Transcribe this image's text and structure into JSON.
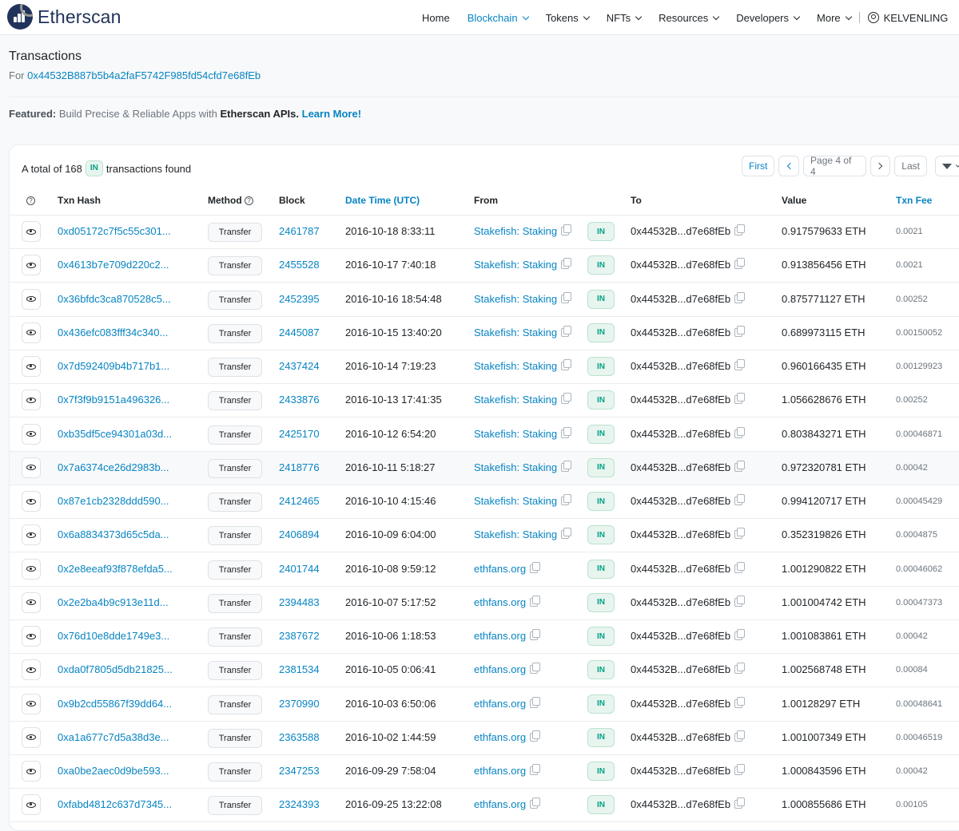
{
  "header": {
    "logo_text": "Etherscan",
    "nav": [
      {
        "label": "Home",
        "dropdown": false,
        "active": false
      },
      {
        "label": "Blockchain",
        "dropdown": true,
        "active": true
      },
      {
        "label": "Tokens",
        "dropdown": true,
        "active": false
      },
      {
        "label": "NFTs",
        "dropdown": true,
        "active": false
      },
      {
        "label": "Resources",
        "dropdown": true,
        "active": false
      },
      {
        "label": "Developers",
        "dropdown": true,
        "active": false
      },
      {
        "label": "More",
        "dropdown": true,
        "active": false
      }
    ],
    "user": "KELVENLING"
  },
  "page": {
    "title": "Transactions",
    "for_label": "For",
    "address": "0x44532B887b5b4a2faF5742F985fd54cfd7e68fEb"
  },
  "featured": {
    "label": "Featured:",
    "text": "Build Precise & Reliable Apps with",
    "brand": "Etherscan APIs.",
    "link": "Learn More!"
  },
  "summary": {
    "prefix": "A total of 168",
    "badge": "IN",
    "suffix": "transactions found"
  },
  "pager": {
    "first": "First",
    "page": "Page 4 of 4",
    "last": "Last"
  },
  "columns": {
    "txn_hash": "Txn Hash",
    "method": "Method",
    "block": "Block",
    "datetime": "Date Time (UTC)",
    "from": "From",
    "to": "To",
    "value": "Value",
    "fee": "Txn Fee"
  },
  "rows": [
    {
      "hash": "0xd05172c7f5c55c301...",
      "method": "Transfer",
      "block": "2461787",
      "time": "2016-10-18 8:33:11",
      "from": "Stakefish: Staking",
      "dir": "IN",
      "to": "0x44532B...d7e68fEb",
      "value": "0.917579633 ETH",
      "fee": "0.0021"
    },
    {
      "hash": "0x4613b7e709d220c2...",
      "method": "Transfer",
      "block": "2455528",
      "time": "2016-10-17 7:40:18",
      "from": "Stakefish: Staking",
      "dir": "IN",
      "to": "0x44532B...d7e68fEb",
      "value": "0.913856456 ETH",
      "fee": "0.0021"
    },
    {
      "hash": "0x36bfdc3ca870528c5...",
      "method": "Transfer",
      "block": "2452395",
      "time": "2016-10-16 18:54:48",
      "from": "Stakefish: Staking",
      "dir": "IN",
      "to": "0x44532B...d7e68fEb",
      "value": "0.875771127 ETH",
      "fee": "0.00252"
    },
    {
      "hash": "0x436efc083fff34c340...",
      "method": "Transfer",
      "block": "2445087",
      "time": "2016-10-15 13:40:20",
      "from": "Stakefish: Staking",
      "dir": "IN",
      "to": "0x44532B...d7e68fEb",
      "value": "0.689973115 ETH",
      "fee": "0.00150052"
    },
    {
      "hash": "0x7d592409b4b717b1...",
      "method": "Transfer",
      "block": "2437424",
      "time": "2016-10-14 7:19:23",
      "from": "Stakefish: Staking",
      "dir": "IN",
      "to": "0x44532B...d7e68fEb",
      "value": "0.960166435 ETH",
      "fee": "0.00129923"
    },
    {
      "hash": "0x7f3f9b9151a496326...",
      "method": "Transfer",
      "block": "2433876",
      "time": "2016-10-13 17:41:35",
      "from": "Stakefish: Staking",
      "dir": "IN",
      "to": "0x44532B...d7e68fEb",
      "value": "1.056628676 ETH",
      "fee": "0.00252"
    },
    {
      "hash": "0xb35df5ce94301a03d...",
      "method": "Transfer",
      "block": "2425170",
      "time": "2016-10-12 6:54:20",
      "from": "Stakefish: Staking",
      "dir": "IN",
      "to": "0x44532B...d7e68fEb",
      "value": "0.803843271 ETH",
      "fee": "0.00046871"
    },
    {
      "hash": "0x7a6374ce26d2983b...",
      "method": "Transfer",
      "block": "2418776",
      "time": "2016-10-11 5:18:27",
      "from": "Stakefish: Staking",
      "dir": "IN",
      "to": "0x44532B...d7e68fEb",
      "value": "0.972320781 ETH",
      "fee": "0.00042"
    },
    {
      "hash": "0x87e1cb2328ddd590...",
      "method": "Transfer",
      "block": "2412465",
      "time": "2016-10-10 4:15:46",
      "from": "Stakefish: Staking",
      "dir": "IN",
      "to": "0x44532B...d7e68fEb",
      "value": "0.994120717 ETH",
      "fee": "0.00045429"
    },
    {
      "hash": "0x6a8834373d65c5da...",
      "method": "Transfer",
      "block": "2406894",
      "time": "2016-10-09 6:04:00",
      "from": "Stakefish: Staking",
      "dir": "IN",
      "to": "0x44532B...d7e68fEb",
      "value": "0.352319826 ETH",
      "fee": "0.0004875"
    },
    {
      "hash": "0x2e8eeaf93f878efda5...",
      "method": "Transfer",
      "block": "2401744",
      "time": "2016-10-08 9:59:12",
      "from": "ethfans.org",
      "dir": "IN",
      "to": "0x44532B...d7e68fEb",
      "value": "1.001290822 ETH",
      "fee": "0.00046062"
    },
    {
      "hash": "0x2e2ba4b9c913e11d...",
      "method": "Transfer",
      "block": "2394483",
      "time": "2016-10-07 5:17:52",
      "from": "ethfans.org",
      "dir": "IN",
      "to": "0x44532B...d7e68fEb",
      "value": "1.001004742 ETH",
      "fee": "0.00047373"
    },
    {
      "hash": "0x76d10e8dde1749e3...",
      "method": "Transfer",
      "block": "2387672",
      "time": "2016-10-06 1:18:53",
      "from": "ethfans.org",
      "dir": "IN",
      "to": "0x44532B...d7e68fEb",
      "value": "1.001083861 ETH",
      "fee": "0.00042"
    },
    {
      "hash": "0xda0f7805d5db21825...",
      "method": "Transfer",
      "block": "2381534",
      "time": "2016-10-05 0:06:41",
      "from": "ethfans.org",
      "dir": "IN",
      "to": "0x44532B...d7e68fEb",
      "value": "1.002568748 ETH",
      "fee": "0.00084"
    },
    {
      "hash": "0x9b2cd55867f39dd64...",
      "method": "Transfer",
      "block": "2370990",
      "time": "2016-10-03 6:50:06",
      "from": "ethfans.org",
      "dir": "IN",
      "to": "0x44532B...d7e68fEb",
      "value": "1.00128297 ETH",
      "fee": "0.00048641"
    },
    {
      "hash": "0xa1a677c7d5a38d3e...",
      "method": "Transfer",
      "block": "2363588",
      "time": "2016-10-02 1:44:59",
      "from": "ethfans.org",
      "dir": "IN",
      "to": "0x44532B...d7e68fEb",
      "value": "1.001007349 ETH",
      "fee": "0.00046519"
    },
    {
      "hash": "0xa0be2aec0d9be593...",
      "method": "Transfer",
      "block": "2347253",
      "time": "2016-09-29 7:58:04",
      "from": "ethfans.org",
      "dir": "IN",
      "to": "0x44532B...d7e68fEb",
      "value": "1.000843596 ETH",
      "fee": "0.00042"
    },
    {
      "hash": "0xfabd4812c637d7345...",
      "method": "Transfer",
      "block": "2324393",
      "time": "2016-09-25 13:22:08",
      "from": "ethfans.org",
      "dir": "IN",
      "to": "0x44532B...d7e68fEb",
      "value": "1.000855686 ETH",
      "fee": "0.00105"
    }
  ],
  "highlighted_row": 7,
  "colors": {
    "link": "#0784c3",
    "in_badge_text": "#00a186",
    "in_badge_bg": "#e8f5ef",
    "brand": "#21325b"
  }
}
